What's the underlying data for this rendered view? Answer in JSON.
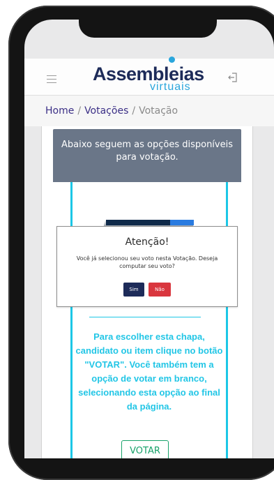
{
  "header": {
    "logo_main": "Assembleias",
    "logo_sub": "virtuais",
    "menu_icon": "hamburger-menu-icon",
    "exit_icon": "logout-icon"
  },
  "breadcrumb": {
    "home": "Home",
    "separator": "/",
    "votacoes": "Votações",
    "current": "Votação"
  },
  "banner": {
    "text": "Abaixo seguem as opções disponíveis para votação."
  },
  "card": {
    "instructions": "Para escolher esta chapa, candidato ou item clique no botão \"VOTAR\". Você também tem a opção de votar em branco, selecionando esta opção ao final da página.",
    "vote_label": "VOTAR"
  },
  "modal": {
    "title": "Atenção!",
    "message": "Você já selecionou seu voto nesta Votação. Deseja computar seu voto?",
    "yes_label": "Sim",
    "no_label": "Não"
  },
  "colors": {
    "brand_dark": "#1d2b59",
    "brand_light": "#2aa6dc",
    "accent_cyan": "#1cc7e6",
    "vote_green": "#17a26a",
    "danger_red": "#d9363e"
  }
}
